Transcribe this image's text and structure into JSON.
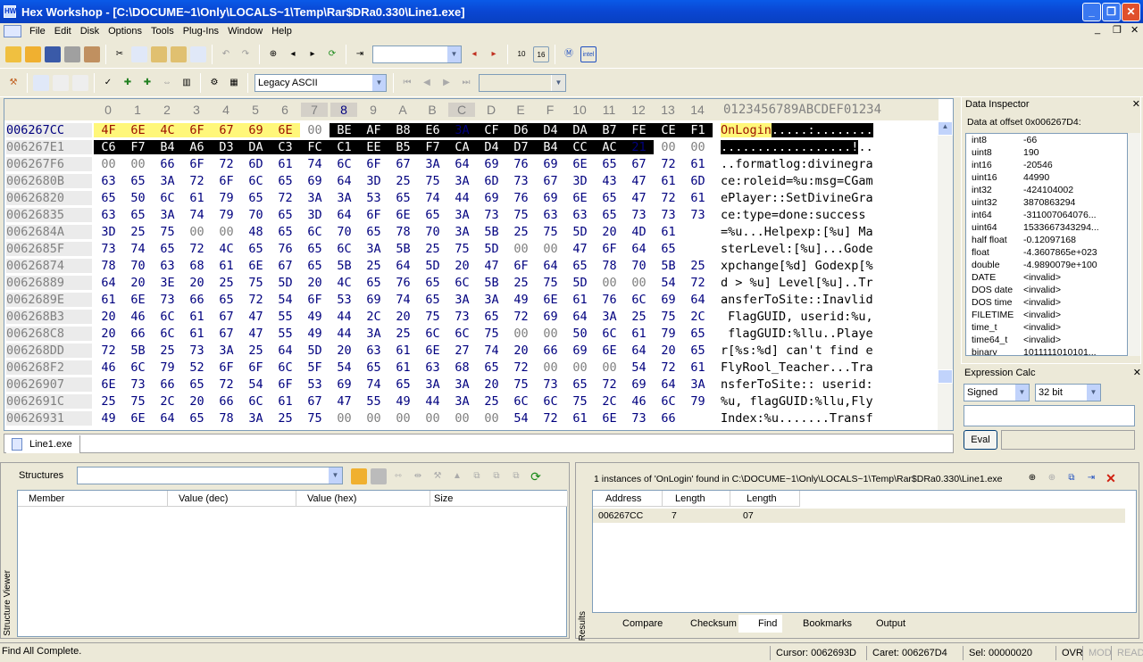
{
  "window": {
    "title": "Hex Workshop - [C:\\DOCUME~1\\Only\\LOCALS~1\\Temp\\Rar$DRa0.330\\Line1.exe]",
    "minimize": "_",
    "restore": "❐",
    "close": "✕"
  },
  "menu": [
    "File",
    "Edit",
    "Disk",
    "Options",
    "Tools",
    "Plug-Ins",
    "Window",
    "Help"
  ],
  "toolbar": {
    "encoding": "Legacy ASCII"
  },
  "hex": {
    "col_headers": [
      "0",
      "1",
      "2",
      "3",
      "4",
      "5",
      "6",
      "7",
      "8",
      "9",
      "A",
      "B",
      "C",
      "D",
      "E",
      "F",
      "10",
      "11",
      "12",
      "13",
      "14"
    ],
    "ascii_header": "0123456789ABCDEF01234",
    "rows": [
      {
        "addr": "006267CC",
        "bytes": [
          "4F",
          "6E",
          "4C",
          "6F",
          "67",
          "69",
          "6E",
          "00",
          "BE",
          "AF",
          "B8",
          "E6",
          "3A",
          "CF",
          "D6",
          "D4",
          "DA",
          "B7",
          "FE",
          "CE",
          "F1"
        ],
        "ascii": "OnLogin.....:........"
      },
      {
        "addr": "006267E1",
        "bytes": [
          "C6",
          "F7",
          "B4",
          "A6",
          "D3",
          "DA",
          "C3",
          "FC",
          "C1",
          "EE",
          "B5",
          "F7",
          "CA",
          "D4",
          "D7",
          "B4",
          "CC",
          "AC",
          "21",
          "00",
          "00"
        ],
        "ascii": "..................!.."
      },
      {
        "addr": "006267F6",
        "bytes": [
          "00",
          "00",
          "66",
          "6F",
          "72",
          "6D",
          "61",
          "74",
          "6C",
          "6F",
          "67",
          "3A",
          "64",
          "69",
          "76",
          "69",
          "6E",
          "65",
          "67",
          "72",
          "61"
        ],
        "ascii": "..formatlog:divinegra"
      },
      {
        "addr": "0062680B",
        "bytes": [
          "63",
          "65",
          "3A",
          "72",
          "6F",
          "6C",
          "65",
          "69",
          "64",
          "3D",
          "25",
          "75",
          "3A",
          "6D",
          "73",
          "67",
          "3D",
          "43",
          "47",
          "61",
          "6D"
        ],
        "ascii": "ce:roleid=%u:msg=CGam"
      },
      {
        "addr": "00626820",
        "bytes": [
          "65",
          "50",
          "6C",
          "61",
          "79",
          "65",
          "72",
          "3A",
          "3A",
          "53",
          "65",
          "74",
          "44",
          "69",
          "76",
          "69",
          "6E",
          "65",
          "47",
          "72",
          "61"
        ],
        "ascii": "ePlayer::SetDivineGra"
      },
      {
        "addr": "00626835",
        "bytes": [
          "63",
          "65",
          "3A",
          "74",
          "79",
          "70",
          "65",
          "3D",
          "64",
          "6F",
          "6E",
          "65",
          "3A",
          "73",
          "75",
          "63",
          "63",
          "65",
          "73",
          "73",
          "73"
        ],
        "ascii": "ce:type=done:success"
      },
      {
        "addr": "0062684A",
        "bytes": [
          "3D",
          "25",
          "75",
          "00",
          "00",
          "48",
          "65",
          "6C",
          "70",
          "65",
          "78",
          "70",
          "3A",
          "5B",
          "25",
          "75",
          "5D",
          "20",
          "4D",
          "61"
        ],
        "ascii": "=%u...Helpexp:[%u] Ma"
      },
      {
        "addr": "0062685F",
        "bytes": [
          "73",
          "74",
          "65",
          "72",
          "4C",
          "65",
          "76",
          "65",
          "6C",
          "3A",
          "5B",
          "25",
          "75",
          "5D",
          "00",
          "00",
          "47",
          "6F",
          "64",
          "65"
        ],
        "ascii": "sterLevel:[%u]...Gode"
      },
      {
        "addr": "00626874",
        "bytes": [
          "78",
          "70",
          "63",
          "68",
          "61",
          "6E",
          "67",
          "65",
          "5B",
          "25",
          "64",
          "5D",
          "20",
          "47",
          "6F",
          "64",
          "65",
          "78",
          "70",
          "5B",
          "25"
        ],
        "ascii": "xpchange[%d] Godexp[%"
      },
      {
        "addr": "00626889",
        "bytes": [
          "64",
          "20",
          "3E",
          "20",
          "25",
          "75",
          "5D",
          "20",
          "4C",
          "65",
          "76",
          "65",
          "6C",
          "5B",
          "25",
          "75",
          "5D",
          "00",
          "00",
          "54",
          "72"
        ],
        "ascii": "d > %u] Level[%u]..Tr"
      },
      {
        "addr": "0062689E",
        "bytes": [
          "61",
          "6E",
          "73",
          "66",
          "65",
          "72",
          "54",
          "6F",
          "53",
          "69",
          "74",
          "65",
          "3A",
          "3A",
          "49",
          "6E",
          "61",
          "76",
          "6C",
          "69",
          "64"
        ],
        "ascii": "ansferToSite::Inavlid"
      },
      {
        "addr": "006268B3",
        "bytes": [
          "20",
          "46",
          "6C",
          "61",
          "67",
          "47",
          "55",
          "49",
          "44",
          "2C",
          "20",
          "75",
          "73",
          "65",
          "72",
          "69",
          "64",
          "3A",
          "25",
          "75",
          "2C"
        ],
        "ascii": " FlagGUID, userid:%u,"
      },
      {
        "addr": "006268C8",
        "bytes": [
          "20",
          "66",
          "6C",
          "61",
          "67",
          "47",
          "55",
          "49",
          "44",
          "3A",
          "25",
          "6C",
          "6C",
          "75",
          "00",
          "00",
          "50",
          "6C",
          "61",
          "79",
          "65"
        ],
        "ascii": " flagGUID:%llu..Playe"
      },
      {
        "addr": "006268DD",
        "bytes": [
          "72",
          "5B",
          "25",
          "73",
          "3A",
          "25",
          "64",
          "5D",
          "20",
          "63",
          "61",
          "6E",
          "27",
          "74",
          "20",
          "66",
          "69",
          "6E",
          "64",
          "20",
          "65"
        ],
        "ascii": "r[%s:%d] can't find e"
      },
      {
        "addr": "006268F2",
        "bytes": [
          "46",
          "6C",
          "79",
          "52",
          "6F",
          "6F",
          "6C",
          "5F",
          "54",
          "65",
          "61",
          "63",
          "68",
          "65",
          "72",
          "00",
          "00",
          "00",
          "54",
          "72",
          "61"
        ],
        "ascii": "FlyRool_Teacher...Tra"
      },
      {
        "addr": "00626907",
        "bytes": [
          "6E",
          "73",
          "66",
          "65",
          "72",
          "54",
          "6F",
          "53",
          "69",
          "74",
          "65",
          "3A",
          "3A",
          "20",
          "75",
          "73",
          "65",
          "72",
          "69",
          "64",
          "3A"
        ],
        "ascii": "nsferToSite:: userid:"
      },
      {
        "addr": "0062691C",
        "bytes": [
          "25",
          "75",
          "2C",
          "20",
          "66",
          "6C",
          "61",
          "67",
          "47",
          "55",
          "49",
          "44",
          "3A",
          "25",
          "6C",
          "6C",
          "75",
          "2C",
          "46",
          "6C",
          "79"
        ],
        "ascii": "%u, flagGUID:%llu,Fly"
      },
      {
        "addr": "00626931",
        "bytes": [
          "49",
          "6E",
          "64",
          "65",
          "78",
          "3A",
          "25",
          "75",
          "00",
          "00",
          "00",
          "00",
          "00",
          "00",
          "54",
          "72",
          "61",
          "6E",
          "73",
          "66"
        ],
        "ascii": "Index:%u.......Transf"
      }
    ]
  },
  "doc_tab": "Line1.exe",
  "data_inspector": {
    "title": "Data Inspector",
    "offset_label": "Data at offset 0x006267D4:",
    "rows": [
      [
        "int8",
        "-66"
      ],
      [
        "uint8",
        "190"
      ],
      [
        "int16",
        "-20546"
      ],
      [
        "uint16",
        "44990"
      ],
      [
        "int32",
        "-424104002"
      ],
      [
        "uint32",
        "3870863294"
      ],
      [
        "int64",
        "-311007064076..."
      ],
      [
        "uint64",
        "1533667343294..."
      ],
      [
        "half float",
        "-0.12097168"
      ],
      [
        "float",
        "-4.3607865e+023"
      ],
      [
        "double",
        "-4.9890079e+100"
      ],
      [
        "DATE",
        "<invalid>"
      ],
      [
        "DOS date",
        "<invalid>"
      ],
      [
        "DOS time",
        "<invalid>"
      ],
      [
        "FILETIME",
        "<invalid>"
      ],
      [
        "time_t",
        "<invalid>"
      ],
      [
        "time64_t",
        "<invalid>"
      ],
      [
        "binary",
        "1011111010101..."
      ]
    ]
  },
  "expr_calc": {
    "title": "Expression Calc",
    "signed": "Signed",
    "bits": "32 bit",
    "eval": "Eval"
  },
  "structures": {
    "label": "Structures",
    "cols": [
      "Member",
      "Value (dec)",
      "Value (hex)",
      "Size"
    ],
    "side": "Structure Viewer"
  },
  "results": {
    "summary": "1 instances of 'OnLogin' found in C:\\DOCUME~1\\Only\\LOCALS~1\\Temp\\Rar$DRa0.330\\Line1.exe",
    "cols": [
      "Address",
      "Length",
      "Length"
    ],
    "row": [
      "006267CC",
      "7",
      "07"
    ],
    "tabs": [
      "Compare",
      "Checksum",
      "Find",
      "Bookmarks",
      "Output"
    ],
    "side": "Results"
  },
  "status": {
    "msg": "Find All Complete.",
    "cursor": "Cursor: 0062693D",
    "caret": "Caret: 006267D4",
    "sel": "Sel: 00000020",
    "ovr": "OVR",
    "mod": "MOD",
    "read": "READ"
  }
}
